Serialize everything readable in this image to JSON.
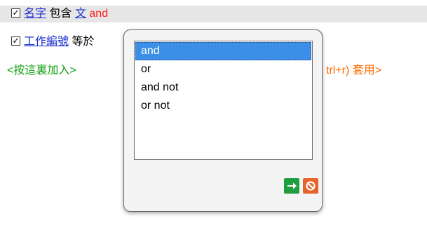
{
  "rows": [
    {
      "checked": true,
      "field_link": "名字",
      "operator_text": "包含",
      "value_link": "文",
      "logic_label": "and"
    },
    {
      "checked": true,
      "field_link": "工作編號",
      "operator_text": "等於"
    }
  ],
  "add_row": {
    "label": "<按這裏加入>",
    "apply_label": "trl+r) 套用>"
  },
  "popup": {
    "options": [
      "and",
      "or",
      "and not",
      "or not"
    ],
    "selected_index": 0,
    "ok_icon": "arrow-right-icon",
    "cancel_icon": "cancel-icon"
  },
  "colors": {
    "link": "#1a2fd0",
    "logic_red": "#ff1a1a",
    "add_green": "#14a014",
    "apply_orange": "#ff6a00",
    "selection": "#3c8fe6",
    "ok_button": "#1e9e3e",
    "cancel_button": "#e8632a"
  }
}
